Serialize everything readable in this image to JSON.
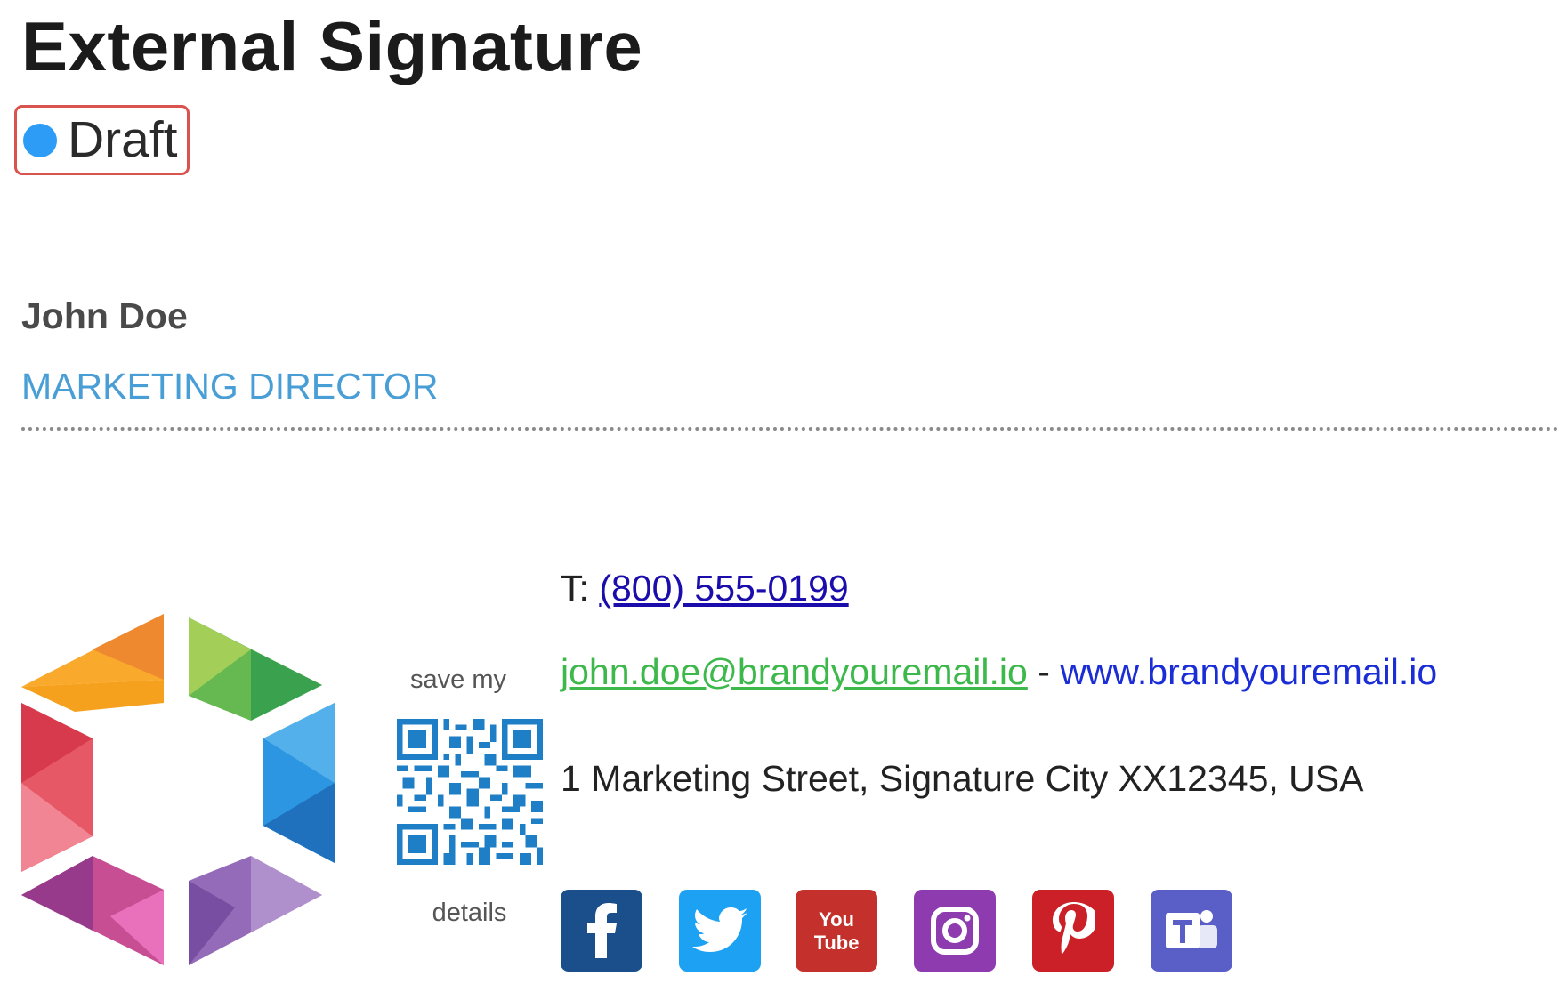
{
  "header": {
    "title": "External Signature",
    "status": {
      "label": "Draft",
      "dot_color": "#2c9cf6",
      "border_color": "#d9534f"
    }
  },
  "signature": {
    "name": "John Doe",
    "job_title": "MARKETING DIRECTOR",
    "qr_caption_top": "save my",
    "qr_caption_bottom": "details",
    "phone_prefix": "T:",
    "phone": "(800) 555-0199",
    "email": "john.doe@brandyouremail.io",
    "separator": "-",
    "website": "www.brandyouremail.io",
    "address": "1 Marketing Street, Signature City XX12345, USA",
    "social_links": [
      {
        "name": "facebook-icon",
        "color": "#1a4f8b"
      },
      {
        "name": "twitter-icon",
        "color": "#1da1f2"
      },
      {
        "name": "youtube-icon",
        "color": "#c4302b"
      },
      {
        "name": "instagram-icon",
        "color": "#8e3bb0"
      },
      {
        "name": "pinterest-icon",
        "color": "#cb2027"
      },
      {
        "name": "teams-icon",
        "color": "#5a5fc7"
      }
    ]
  }
}
